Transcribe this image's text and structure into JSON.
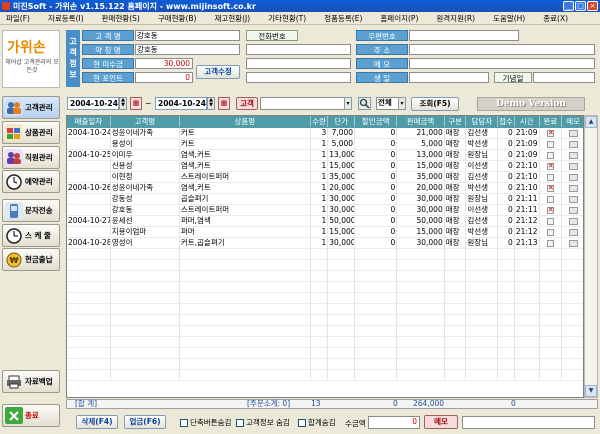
{
  "window": {
    "title": "미진Soft - 가위손 v1.15.122 홈페이지 - www.mijinsoft.co.kr"
  },
  "menu": [
    "파일(F)",
    "자료등록(I)",
    "판매현황(S)",
    "구매현황(B)",
    "재고현황(J)",
    "기타현황(T)",
    "정품등록(E)",
    "홈페이지(P)",
    "원격지원(R)",
    "도움말(H)",
    "종료(X)"
  ],
  "logo": {
    "brand": "가위손",
    "tagline": "헤어샵 고객관리의 모든것"
  },
  "sidebar": [
    {
      "label": "고객관리",
      "icon": "people-icon"
    },
    {
      "label": "상품관리",
      "icon": "products-icon"
    },
    {
      "label": "직원관리",
      "icon": "staff-icon"
    },
    {
      "label": "예약관리",
      "icon": "clock-icon"
    },
    {
      "label": "문자전송",
      "icon": "phone-icon"
    },
    {
      "label": "스 케 줄",
      "icon": "schedule-icon"
    },
    {
      "label": "현금출납",
      "icon": "cash-icon"
    },
    {
      "label": "자료백업",
      "icon": "printer-icon"
    },
    {
      "label": "종료",
      "icon": "exit-icon"
    }
  ],
  "customer": {
    "section_label": "고객정보",
    "name_label": "고 객 명",
    "name": "강호동",
    "nick_label": "약 칭 명",
    "nick": "강호동",
    "unpaid_label": "현 미수금",
    "unpaid": "30,000",
    "points_label": "현 포인트",
    "points": "0",
    "edit_button": "고객수정",
    "phone_label": "전화번호",
    "phone": "",
    "postal_label": "우편번호",
    "postal": "",
    "address_label": "주    소",
    "address": "",
    "memo_label": "메    모",
    "memo": "",
    "birthday_label": "생    일",
    "birthday": "",
    "anniversary_label": "기념일",
    "anniversary": ""
  },
  "filter": {
    "date_from": "2004-10-24",
    "date_to": "2004-10-24",
    "customer_button": "고객",
    "scope": "전체",
    "search_button": "조회(F5)",
    "demo_label": "Demo Version"
  },
  "table": {
    "columns": [
      "매출일자",
      "고객명",
      "상품명",
      "수량",
      "단가",
      "할인금액",
      "판매금액",
      "구분",
      "담당자",
      "접수",
      "시간",
      "완료",
      "메모"
    ],
    "rows": [
      {
        "date": "2004-10-24",
        "customer": "성윤이네가족",
        "product": "커트",
        "qty": "3",
        "price": "7,000",
        "discount": "0",
        "amount": "21,000",
        "type": "매장",
        "staff": "김선생",
        "recv": "0",
        "time": "21:09",
        "done": true
      },
      {
        "date": "",
        "customer": "용성이",
        "product": "커트",
        "qty": "1",
        "price": "5,000",
        "discount": "0",
        "amount": "5,000",
        "type": "매장",
        "staff": "박선생",
        "recv": "0",
        "time": "21:09",
        "done": false
      },
      {
        "date": "2004-10-25",
        "customer": "이미우",
        "product": "염색,커트",
        "qty": "1",
        "price": "13,000",
        "discount": "0",
        "amount": "13,000",
        "type": "매장",
        "staff": "원장님",
        "recv": "0",
        "time": "21:09",
        "done": false
      },
      {
        "date": "",
        "customer": "신용성",
        "product": "염색,커트",
        "qty": "1",
        "price": "15,000",
        "discount": "0",
        "amount": "15,000",
        "type": "매장",
        "staff": "이선생",
        "recv": "0",
        "time": "21:10",
        "done": true
      },
      {
        "date": "",
        "customer": "이현정",
        "product": "스트레이트퍼머",
        "qty": "1",
        "price": "35,000",
        "discount": "0",
        "amount": "35,000",
        "type": "매장",
        "staff": "김선생",
        "recv": "0",
        "time": "21:10",
        "done": false
      },
      {
        "date": "2004-10-26",
        "customer": "성윤이네가족",
        "product": "염색,커트",
        "qty": "1",
        "price": "20,000",
        "discount": "0",
        "amount": "20,000",
        "type": "매장",
        "staff": "박선생",
        "recv": "0",
        "time": "21:10",
        "done": true
      },
      {
        "date": "",
        "customer": "강동성",
        "product": "곱슬펴기",
        "qty": "1",
        "price": "30,000",
        "discount": "0",
        "amount": "30,000",
        "type": "매장",
        "staff": "원장님",
        "recv": "0",
        "time": "21:11",
        "done": false
      },
      {
        "date": "",
        "customer": "강호동",
        "product": "스트레이트퍼머",
        "qty": "1",
        "price": "30,000",
        "discount": "0",
        "amount": "30,000",
        "type": "매장",
        "staff": "이선생",
        "recv": "0",
        "time": "21:11",
        "done": true
      },
      {
        "date": "2004-10-27",
        "customer": "윤세선",
        "product": "퍼머,염색",
        "qty": "1",
        "price": "50,000",
        "discount": "0",
        "amount": "50,000",
        "type": "매장",
        "staff": "김선생",
        "recv": "0",
        "time": "21:12",
        "done": false
      },
      {
        "date": "",
        "customer": "지용이엄마",
        "product": "퍼머",
        "qty": "1",
        "price": "15,000",
        "discount": "0",
        "amount": "15,000",
        "type": "매장",
        "staff": "박선생",
        "recv": "0",
        "time": "21:12",
        "done": false
      },
      {
        "date": "2004-10-28",
        "customer": "영성이",
        "product": "커트,곱슬펴기",
        "qty": "1",
        "price": "30,000",
        "discount": "0",
        "amount": "30,000",
        "type": "매장",
        "staff": "원장님",
        "recv": "0",
        "time": "21:13",
        "done": false
      }
    ]
  },
  "summary": {
    "label": "[합 계]",
    "order_count": "[주문소계: 0]",
    "qty_total": "13",
    "discount_total": "0",
    "amount_total": "264,000",
    "recv_total": "0"
  },
  "bottom": {
    "delete_button": "삭제(F4)",
    "print_button": "업금(F6)",
    "chk1": "단축버튼숨김",
    "chk2": "고객정보 숨김",
    "chk3": "합계숨김",
    "amount_label": "수금액",
    "amount_value": "0",
    "memo_button": "메모"
  }
}
